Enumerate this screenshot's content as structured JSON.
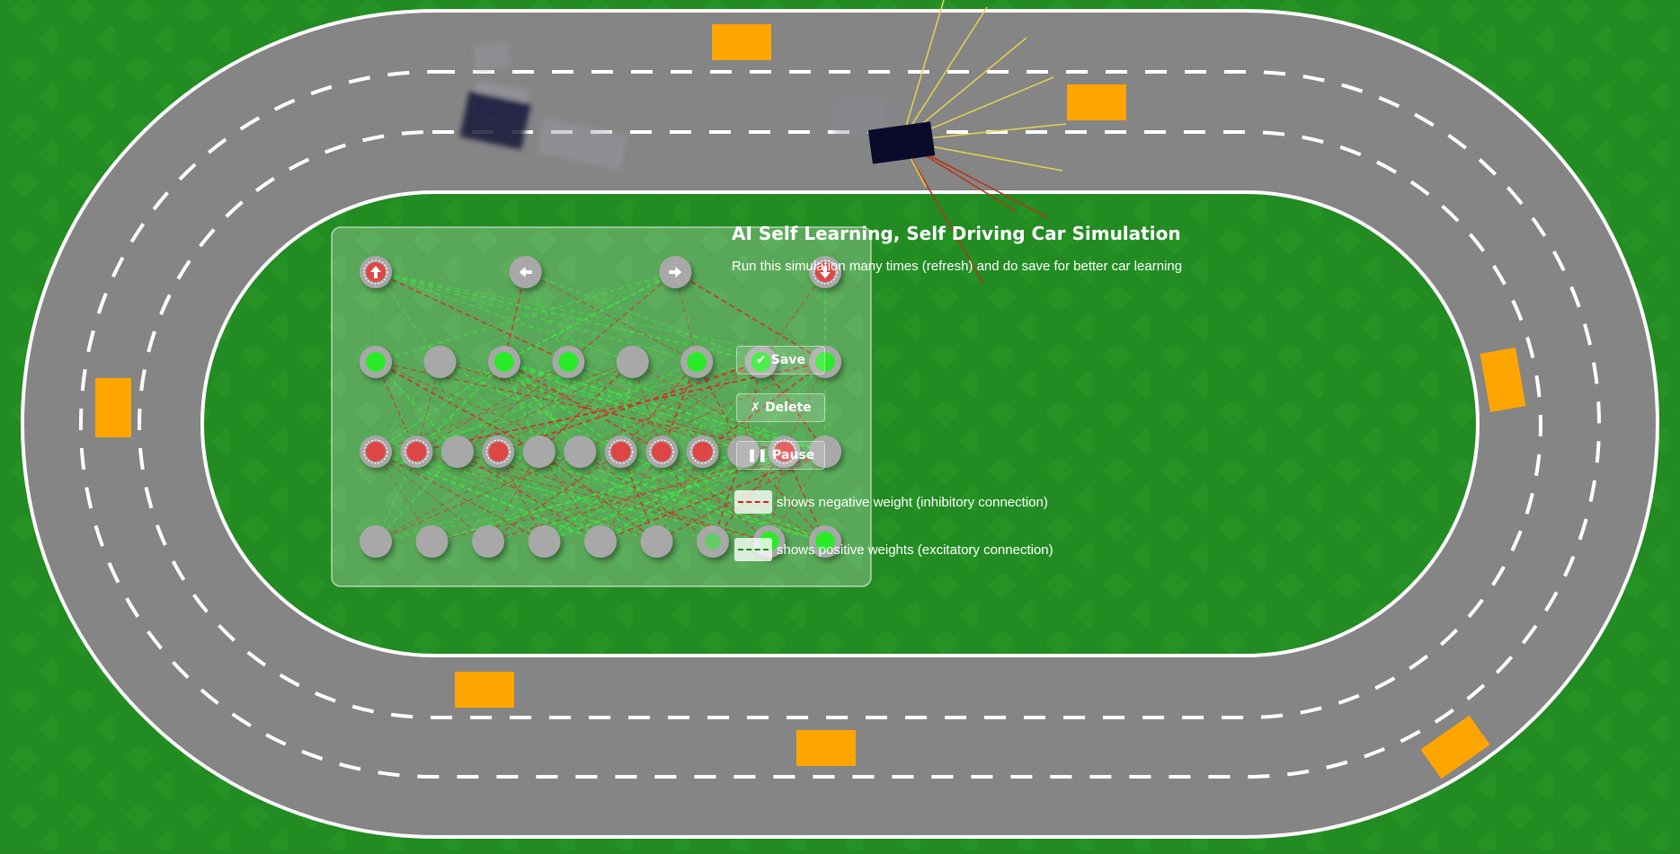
{
  "header": {
    "title": "AI Self Learning, Self Driving Car Simulation",
    "subtitle": "Run this simulation many times (refresh) and do save for better car learning"
  },
  "controls": {
    "save": {
      "label": "Save",
      "icon": "check-icon"
    },
    "delete": {
      "label": "Delete",
      "icon": "cross-icon"
    },
    "pause": {
      "label": "Pause",
      "icon": "pause-icon"
    }
  },
  "legend": {
    "negative": {
      "text": "shows negative weight (inhibitory connection)",
      "color": "#d8201c"
    },
    "positive": {
      "text": "shows positive weights (excitatory connection)",
      "color": "#1f8a1f"
    }
  },
  "network": {
    "output_icons": [
      "arrow-up-icon",
      "arrow-left-icon",
      "arrow-right-icon",
      "arrow-down-icon"
    ],
    "positive_color": "#22ee22",
    "negative_color": "#e04040"
  },
  "colors": {
    "grass": "#238a23",
    "road": "#858585",
    "obstacle": "#ffa500",
    "car": "#0a0a2a",
    "sensor": "#e0d050"
  }
}
